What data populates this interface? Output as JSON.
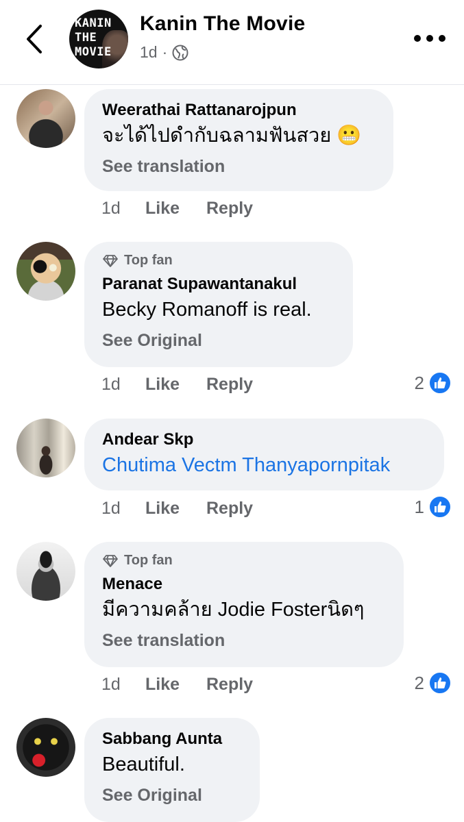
{
  "header": {
    "title": "Kanin The Movie",
    "time": "1d",
    "separator": "·",
    "avatar_logo_lines": [
      "KANIN",
      "THE",
      "MOVIE"
    ]
  },
  "icons": {
    "back": "chevron-left-icon",
    "privacy": "globe-icon",
    "more": "more-icon",
    "topfan": "diamond-icon",
    "like": "thumbs-up-icon"
  },
  "colors": {
    "bubble": "#f0f2f5",
    "link": "#1b74e4",
    "like_badge": "#1877f2",
    "secondary_text": "#65676b"
  },
  "comments": [
    {
      "author": "Weerathai Rattanarojpun",
      "text": "จะได้ไปดำกับฉลามฟันสวย",
      "emoji": "😬",
      "see_label": "See translation",
      "time": "1d",
      "like": "Like",
      "reply": "Reply"
    },
    {
      "badge": "Top fan",
      "author": "Paranat Supawantanakul",
      "text": "Becky Romanoff is real.",
      "see_label": "See Original",
      "time": "1d",
      "like": "Like",
      "reply": "Reply",
      "reactions": "2"
    },
    {
      "author": "Andear Skp",
      "text": "Chutima Vectm Thanyapornpitak",
      "time": "1d",
      "like": "Like",
      "reply": "Reply",
      "reactions": "1"
    },
    {
      "badge": "Top fan",
      "author": "Menace",
      "text": "มีความคล้าย Jodie Fosterนิดๆ",
      "see_label": "See translation",
      "time": "1d",
      "like": "Like",
      "reply": "Reply",
      "reactions": "2"
    },
    {
      "author": "Sabbang Aunta",
      "text": "Beautiful.",
      "see_label": "See Original"
    }
  ]
}
